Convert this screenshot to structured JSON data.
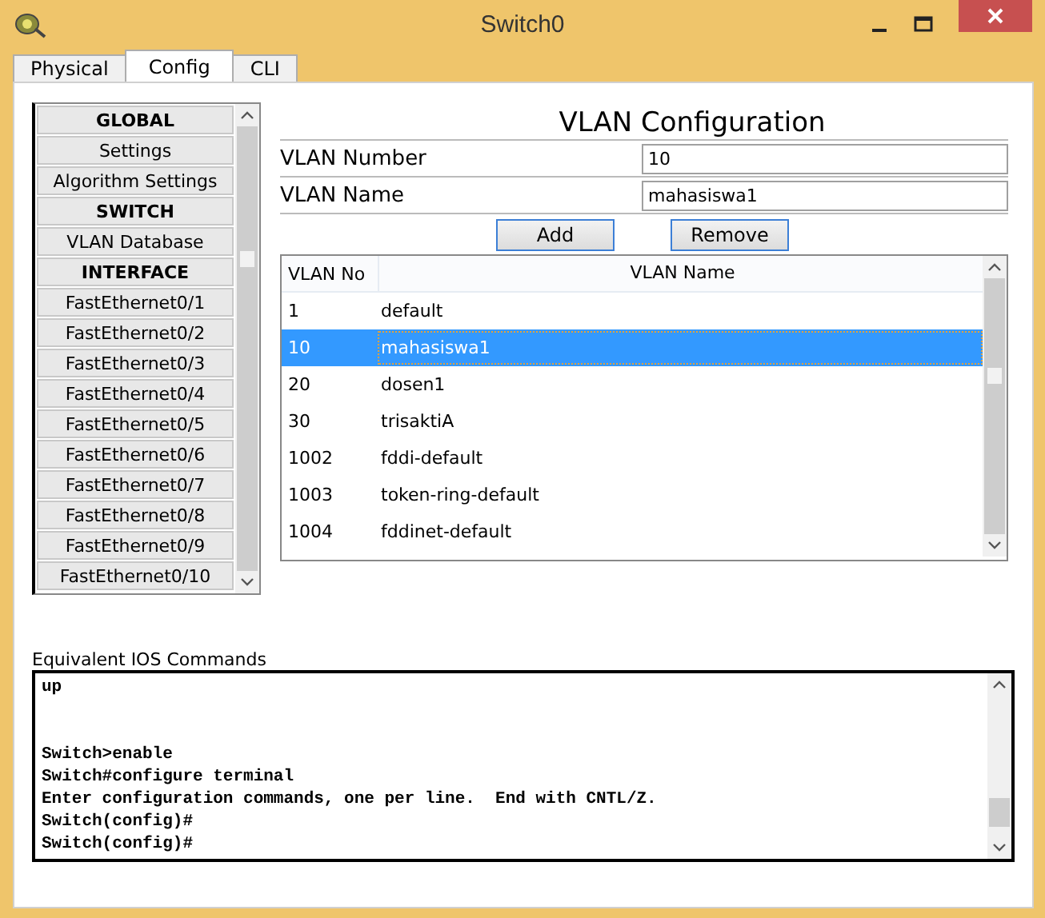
{
  "window": {
    "title": "Switch0"
  },
  "tabs": [
    {
      "label": "Physical",
      "selected": false
    },
    {
      "label": "Config",
      "selected": true
    },
    {
      "label": "CLI",
      "selected": false
    }
  ],
  "sidebar": {
    "items": [
      {
        "label": "GLOBAL",
        "kind": "header"
      },
      {
        "label": "Settings",
        "kind": "item"
      },
      {
        "label": "Algorithm Settings",
        "kind": "item"
      },
      {
        "label": "SWITCH",
        "kind": "header"
      },
      {
        "label": "VLAN Database",
        "kind": "item"
      },
      {
        "label": "INTERFACE",
        "kind": "header"
      },
      {
        "label": "FastEthernet0/1",
        "kind": "item"
      },
      {
        "label": "FastEthernet0/2",
        "kind": "item"
      },
      {
        "label": "FastEthernet0/3",
        "kind": "item"
      },
      {
        "label": "FastEthernet0/4",
        "kind": "item"
      },
      {
        "label": "FastEthernet0/5",
        "kind": "item"
      },
      {
        "label": "FastEthernet0/6",
        "kind": "item"
      },
      {
        "label": "FastEthernet0/7",
        "kind": "item"
      },
      {
        "label": "FastEthernet0/8",
        "kind": "item"
      },
      {
        "label": "FastEthernet0/9",
        "kind": "item"
      },
      {
        "label": "FastEthernet0/10",
        "kind": "item"
      }
    ]
  },
  "vlan_config": {
    "title": "VLAN Configuration",
    "fields": [
      {
        "label": "VLAN Number",
        "value": "10"
      },
      {
        "label": "VLAN Name",
        "value": "mahasiswa1"
      }
    ],
    "buttons": [
      "Add",
      "Remove"
    ],
    "table": {
      "columns": [
        "VLAN No",
        "VLAN Name"
      ],
      "rows": [
        {
          "cells": [
            "1",
            "default"
          ],
          "selected": false
        },
        {
          "cells": [
            "10",
            "mahasiswa1"
          ],
          "selected": true
        },
        {
          "cells": [
            "20",
            "dosen1"
          ],
          "selected": false
        },
        {
          "cells": [
            "30",
            "trisaktiA"
          ],
          "selected": false
        },
        {
          "cells": [
            "1002",
            "fddi-default"
          ],
          "selected": false
        },
        {
          "cells": [
            "1003",
            "token-ring-default"
          ],
          "selected": false
        },
        {
          "cells": [
            "1004",
            "fddinet-default"
          ],
          "selected": false
        }
      ]
    }
  },
  "ios_commands": {
    "label": "Equivalent IOS Commands",
    "blocks": [
      [
        "up"
      ],
      [
        "Switch>enable",
        "Switch#configure terminal",
        "Enter configuration commands, one per line.  End with CNTL/Z.",
        "Switch(config)#",
        "Switch(config)#"
      ]
    ]
  }
}
